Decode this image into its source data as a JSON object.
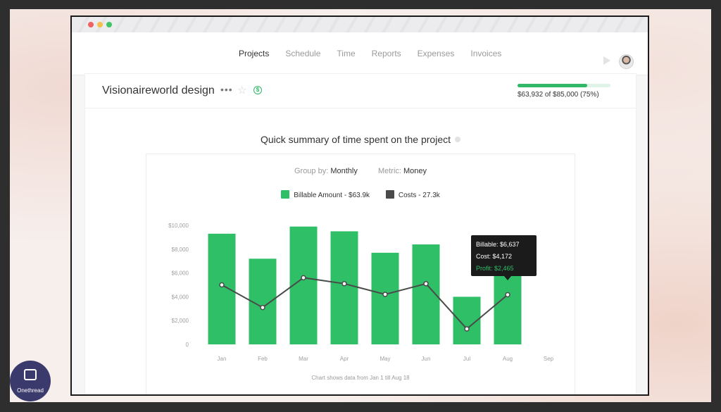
{
  "nav": {
    "items": [
      "Projects",
      "Schedule",
      "Time",
      "Reports",
      "Expenses",
      "Invoices"
    ],
    "active_index": 0
  },
  "project": {
    "title": "Visionaireworld design",
    "budget_text": "$63,932 of $85,000 (75%)",
    "budget_progress": 0.75
  },
  "summary": {
    "title": "Quick summary of time spent on the project",
    "group_by_label": "Group by:",
    "group_by_value": "Monthly",
    "metric_label": "Metric:",
    "metric_value": "Money",
    "legend": [
      {
        "label": "Billable Amount - $63.9k",
        "color": "#2fbf67"
      },
      {
        "label": "Costs - 27.3k",
        "color": "#4a4a4a"
      }
    ],
    "footnote": "Chart shows data from Jan 1 till Aug 18"
  },
  "chart_data": {
    "type": "bar",
    "categories": [
      "Jan",
      "Feb",
      "Mar",
      "Apr",
      "May",
      "Jun",
      "Jul",
      "Aug",
      "Sep"
    ],
    "ylim": [
      0,
      10000
    ],
    "yticks": [
      "0",
      "$2,000",
      "$4,000",
      "$6,000",
      "$8,000",
      "$10,000"
    ],
    "series": [
      {
        "name": "Billable Amount - $63.9k",
        "type": "bar",
        "color": "#2fbf67",
        "values": [
          9300,
          7200,
          9900,
          9500,
          7700,
          8400,
          4000,
          6637,
          null
        ]
      },
      {
        "name": "Costs - 27.3k",
        "type": "line",
        "color": "#4a4a4a",
        "values": [
          5000,
          3100,
          5600,
          5100,
          4200,
          5100,
          1300,
          4172,
          null
        ]
      }
    ],
    "tooltip": {
      "billable": "Billable: $6,637",
      "cost": "Cost: $4,172",
      "profit": "Profit: $2,465"
    }
  },
  "brand": {
    "name": "Onethread"
  }
}
